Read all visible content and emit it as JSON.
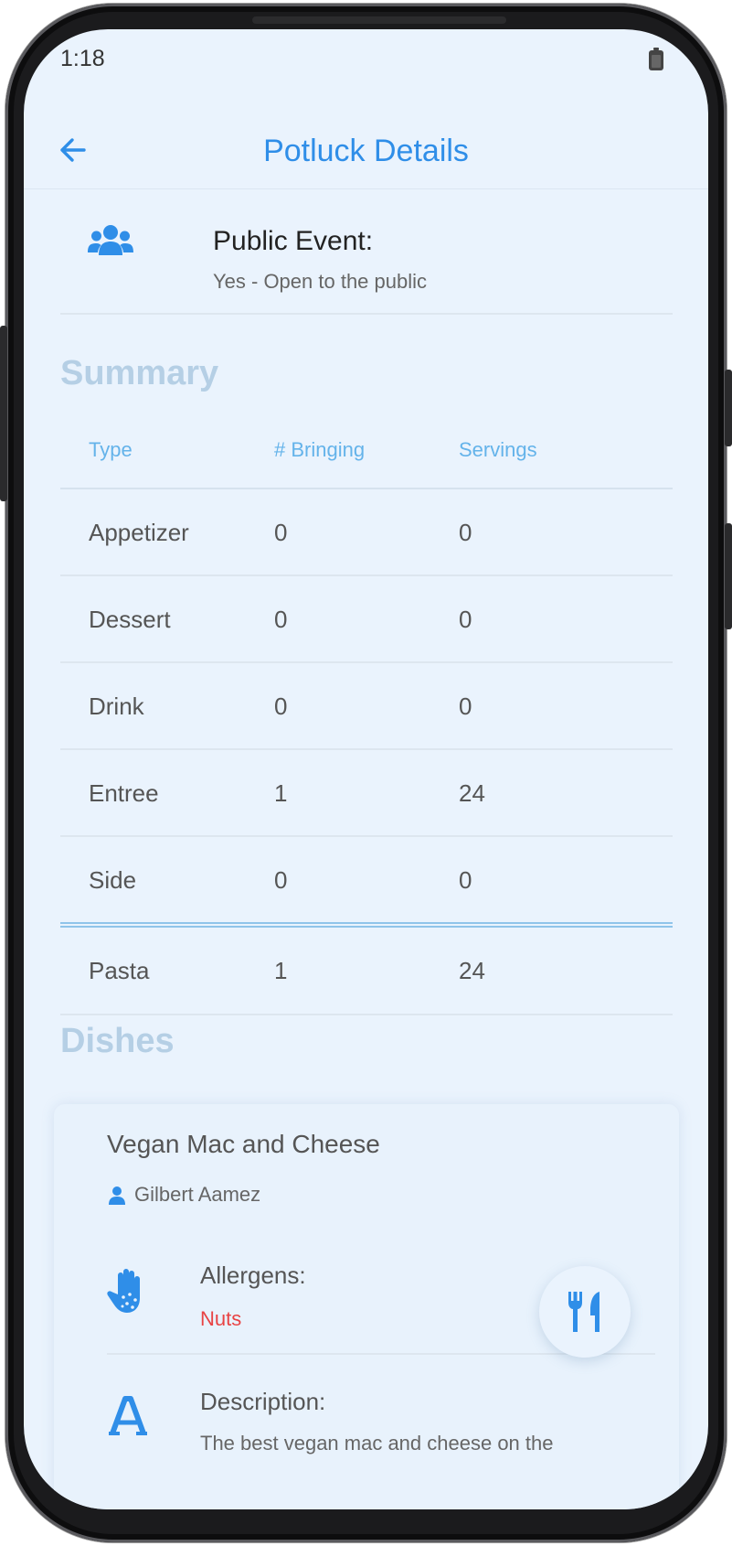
{
  "status_bar": {
    "time": "1:18",
    "battery_icon": "battery-icon"
  },
  "app_bar": {
    "title": "Potluck Details",
    "back_icon": "arrow-left-icon"
  },
  "event": {
    "label": "Public Event:",
    "value": "Yes - Open to the public",
    "icon": "users-icon"
  },
  "summary": {
    "title": "Summary",
    "headers": [
      "Type",
      "# Bringing",
      "Servings"
    ],
    "rows": [
      {
        "type": "Appetizer",
        "bringing": "0",
        "servings": "0"
      },
      {
        "type": "Dessert",
        "bringing": "0",
        "servings": "0"
      },
      {
        "type": "Drink",
        "bringing": "0",
        "servings": "0"
      },
      {
        "type": "Entree",
        "bringing": "1",
        "servings": "24"
      },
      {
        "type": "Side",
        "bringing": "0",
        "servings": "0"
      }
    ],
    "total": {
      "type": "Pasta",
      "bringing": "1",
      "servings": "24"
    }
  },
  "dishes": {
    "title": "Dishes",
    "items": [
      {
        "name": "Vegan Mac and Cheese",
        "owner": "Gilbert Aamez",
        "allergens_label": "Allergens:",
        "allergens": "Nuts",
        "description_label": "Description:",
        "description": "The best vegan mac and cheese on the"
      }
    ]
  },
  "fab": {
    "icon": "utensils-icon"
  },
  "colors": {
    "accent": "#2f8ee8",
    "background": "#eaf3fd",
    "section_title": "#b5cfe5",
    "allergen": "#e84343"
  }
}
